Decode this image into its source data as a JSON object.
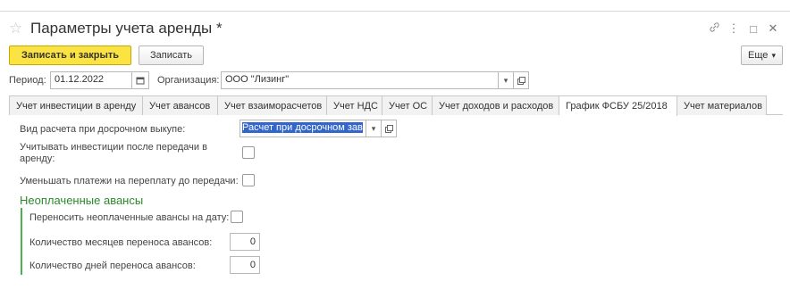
{
  "window": {
    "title": "Параметры учета аренды *",
    "icons": [
      "link-icon",
      "more-icon",
      "maximize-icon",
      "close-icon"
    ]
  },
  "toolbar": {
    "save_close_label": "Записать и закрыть",
    "save_label": "Записать",
    "more_label": "Еще",
    "more_arrow": "▾"
  },
  "period": {
    "label": "Период:",
    "value": "01.12.2022"
  },
  "organization": {
    "label": "Организация:",
    "value": "ООО \"Лизинг\""
  },
  "tabs": [
    {
      "label": "Учет инвестиции в аренду",
      "active": false
    },
    {
      "label": "Учет авансов",
      "active": false
    },
    {
      "label": "Учет взаиморасчетов",
      "active": false
    },
    {
      "label": "Учет НДС",
      "active": false
    },
    {
      "label": "Учет ОС",
      "active": false
    },
    {
      "label": "Учет доходов и расходов",
      "active": false
    },
    {
      "label": "График ФСБУ 25/2018",
      "active": true
    },
    {
      "label": "Учет материалов",
      "active": false
    }
  ],
  "form": {
    "calc_type_label": "Вид расчета при досрочном выкупе:",
    "calc_type_value": "Расчет при досрочном зав",
    "invest_label_line1": "Учитывать инвестиции после передачи в",
    "invest_label_line2": "аренду:",
    "reduce_label": "Уменьшать платежи на переплату до передачи:",
    "section_title": "Неоплаченные авансы",
    "transfer_label": "Переносить неоплаченные авансы на дату:",
    "months_label": "Количество месяцев переноса авансов:",
    "months_value": "0",
    "days_label": "Количество дней переноса авансов:",
    "days_value": "0"
  },
  "colors": {
    "primary_button": "#fbe341",
    "section_title": "#2c8a2c",
    "group_bar": "#4caf50",
    "selection": "#3366cc"
  }
}
